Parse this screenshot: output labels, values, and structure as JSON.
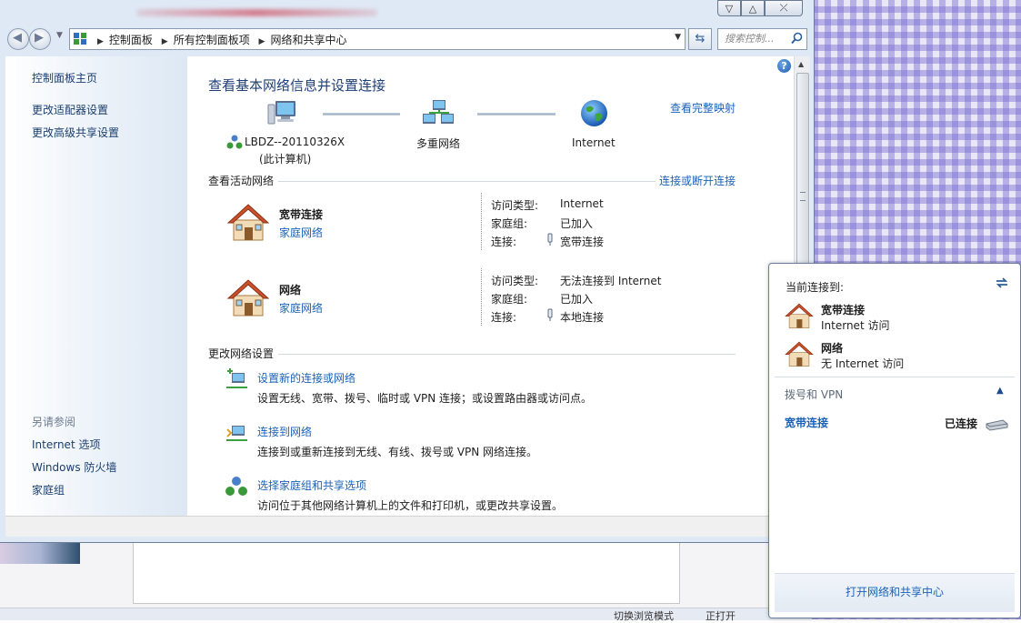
{
  "window": {
    "controls": {
      "minimize": "▽",
      "maximize": "△",
      "close": "⤫"
    }
  },
  "address": {
    "crumbs": [
      "控制面板",
      "所有控制面板项",
      "网络和共享中心"
    ],
    "search_placeholder": "搜索控制..."
  },
  "sidebar": {
    "links": [
      "控制面板主页",
      "更改适配器设置",
      "更改高级共享设置"
    ],
    "see_also_header": "另请参阅",
    "see_also": [
      "Internet 选项",
      "Windows 防火墙",
      "家庭组"
    ]
  },
  "main": {
    "title": "查看基本网络信息并设置连接",
    "map_link": "查看完整映射",
    "map": {
      "computer_name": "LBDZ--20110326X",
      "computer_sub": "(此计算机)",
      "network": "多重网络",
      "internet": "Internet"
    },
    "active": {
      "header": "查看活动网络",
      "connect_link": "连接或断开连接",
      "networks": [
        {
          "name": "宽带连接",
          "type": "家庭网络",
          "access_label": "访问类型:",
          "access": "Internet",
          "homegroup_label": "家庭组:",
          "homegroup": "已加入",
          "conn_label": "连接:",
          "conn": "宽带连接"
        },
        {
          "name": "网络",
          "type": "家庭网络",
          "access_label": "访问类型:",
          "access": "无法连接到 Internet",
          "homegroup_label": "家庭组:",
          "homegroup": "已加入",
          "conn_label": "连接:",
          "conn": "本地连接"
        }
      ]
    },
    "settings": {
      "header": "更改网络设置",
      "items": [
        {
          "title": "设置新的连接或网络",
          "desc": "设置无线、宽带、拨号、临时或 VPN 连接；或设置路由器或访问点。"
        },
        {
          "title": "连接到网络",
          "desc": "连接到或重新连接到无线、有线、拨号或 VPN 网络连接。"
        },
        {
          "title": "选择家庭组和共享选项",
          "desc": "访问位于其他网络计算机上的文件和打印机，或更改共享设置。"
        }
      ]
    }
  },
  "popup": {
    "header": "当前连接到:",
    "connections": [
      {
        "name": "宽带连接",
        "status": "Internet 访问"
      },
      {
        "name": "网络",
        "status": "无 Internet 访问"
      }
    ],
    "vpn_header": "拨号和 VPN",
    "vpn_item": "宽带连接",
    "vpn_status": "已连接",
    "footer": "打开网络和共享中心"
  },
  "background": {
    "status_left": "切换浏览模式",
    "status_right": "正打开"
  },
  "colors": {
    "link": "#1c62b8",
    "title": "#1e3f78",
    "sidebar_link": "#1a3e6e"
  }
}
